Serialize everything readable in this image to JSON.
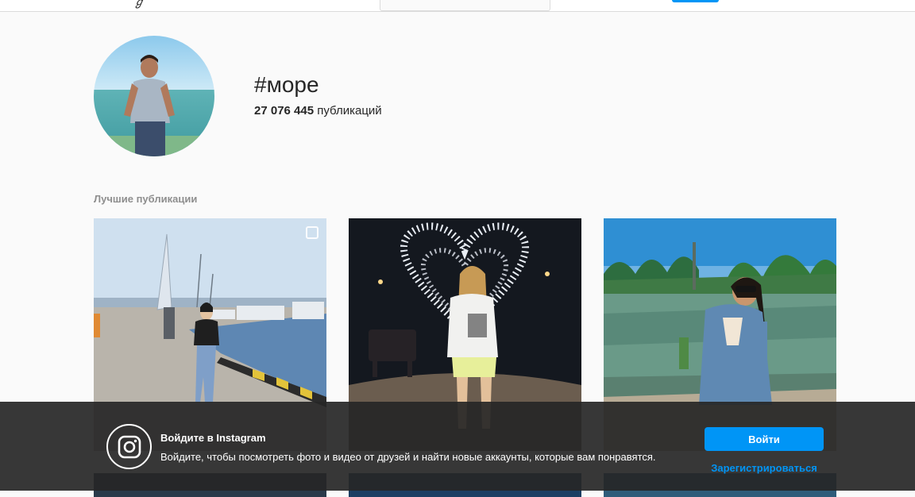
{
  "hashtag": {
    "title": "#море",
    "post_count": "27 076 445",
    "post_count_label": "публикаций"
  },
  "sections": {
    "top_posts_label": "Лучшие публикации"
  },
  "login_prompt": {
    "title": "Войдите в Instagram",
    "text": "Войдите, чтобы посмотреть фото и видео от друзей и найти новые аккаунты, которые вам понравятся.",
    "login_button": "Войти",
    "signup_link": "Зарегистрироваться"
  },
  "colors": {
    "accent": "#0095f6",
    "overlay": "#262626",
    "muted": "#8e8e8e"
  },
  "icons": [
    "instagram-logo-icon",
    "multiple-photos-icon"
  ]
}
